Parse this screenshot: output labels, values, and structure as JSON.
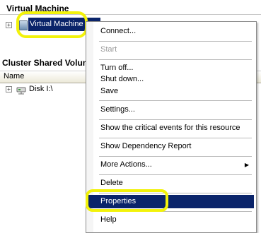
{
  "console": {
    "vm_section_title": "Virtual Machine",
    "vm_row_label": "Virtual Machine",
    "csv_section_title": "Cluster Shared Volume",
    "name_column": "Name",
    "disk_label": "Disk I:\\",
    "expander_symbol": "+"
  },
  "context_menu": {
    "items": [
      {
        "label": "Connect...",
        "enabled": true
      },
      {
        "label": "Start",
        "enabled": false
      },
      {
        "label": "Turn off...",
        "enabled": true
      },
      {
        "label": "Shut down...",
        "enabled": true
      },
      {
        "label": "Save",
        "enabled": true
      },
      {
        "label": "Settings...",
        "enabled": true
      },
      {
        "label": "Show the critical events for this resource",
        "enabled": true
      },
      {
        "label": "Show Dependency Report",
        "enabled": true
      },
      {
        "label": "More Actions...",
        "enabled": true,
        "submenu": true
      },
      {
        "label": "Delete",
        "enabled": true
      },
      {
        "label": "Properties",
        "enabled": true,
        "selected": true
      },
      {
        "label": "Help",
        "enabled": true
      }
    ],
    "submenu_arrow": "▶"
  },
  "colors": {
    "selection": "#0a246a",
    "highlight_oval": "#f2f20a"
  }
}
